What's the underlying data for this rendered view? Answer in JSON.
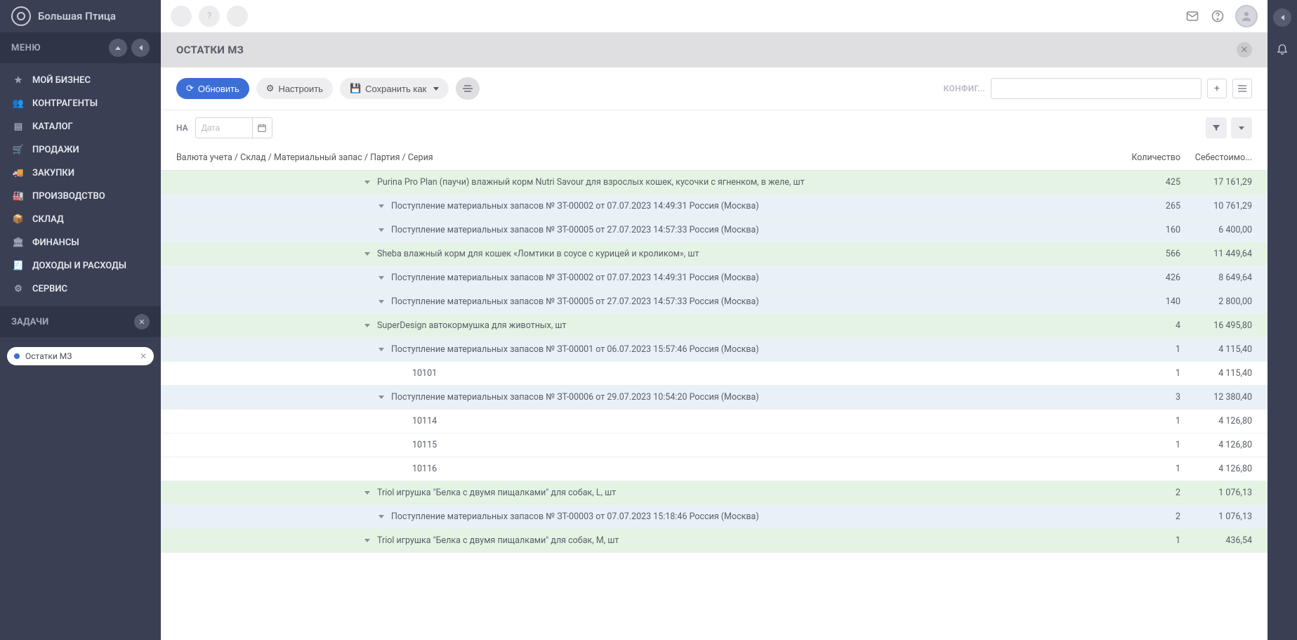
{
  "app": {
    "name": "Большая Птица"
  },
  "sidebar": {
    "menu_label": "МЕНЮ",
    "items": [
      {
        "label": "МОЙ БИЗНЕС",
        "icon": "star"
      },
      {
        "label": "КОНТРАГЕНТЫ",
        "icon": "users"
      },
      {
        "label": "КАТАЛОГ",
        "icon": "book"
      },
      {
        "label": "ПРОДАЖИ",
        "icon": "cart"
      },
      {
        "label": "ЗАКУПКИ",
        "icon": "truck"
      },
      {
        "label": "ПРОИЗВОДСТВО",
        "icon": "factory"
      },
      {
        "label": "СКЛАД",
        "icon": "box"
      },
      {
        "label": "ФИНАНСЫ",
        "icon": "bank"
      },
      {
        "label": "ДОХОДЫ И РАСХОДЫ",
        "icon": "ledger"
      },
      {
        "label": "СЕРВИС",
        "icon": "gear"
      }
    ],
    "tasks_label": "ЗАДАЧИ",
    "task_items": [
      {
        "label": "Остатки МЗ"
      }
    ]
  },
  "page": {
    "title": "ОСТАТКИ МЗ"
  },
  "toolbar": {
    "refresh": "Обновить",
    "configure": "Настроить",
    "save_as": "Сохранить как",
    "config_label": "КОНФИГ..."
  },
  "filter": {
    "on_label": "НА",
    "date_placeholder": "Дата"
  },
  "table": {
    "columns": {
      "name": "Валюта учета / Склад / Материальный запас / Партия / Серия",
      "qty": "Количество",
      "cost": "Себестоимо..."
    },
    "rows": [
      {
        "level": 1,
        "caret": true,
        "name": "Purina Pro Plan (паучи) влажный корм Nutri Savour для взрослых кошек, кусочки с ягненком, в желе, шт",
        "qty": "425",
        "cost": "17 161,29"
      },
      {
        "level": 2,
        "caret": true,
        "name": "Поступление материальных запасов № ЗТ-00002 от 07.07.2023 14:49:31 Россия (Москва)",
        "qty": "265",
        "cost": "10 761,29"
      },
      {
        "level": 2,
        "caret": true,
        "name": "Поступление материальных запасов № ЗТ-00005 от 27.07.2023 14:57:33 Россия (Москва)",
        "qty": "160",
        "cost": "6 400,00"
      },
      {
        "level": 1,
        "caret": true,
        "name": "Sheba влажный корм для кошек «Ломтики в соусе с курицей и кроликом», шт",
        "qty": "566",
        "cost": "11 449,64"
      },
      {
        "level": 2,
        "caret": true,
        "name": "Поступление материальных запасов № ЗТ-00002 от 07.07.2023 14:49:31 Россия (Москва)",
        "qty": "426",
        "cost": "8 649,64"
      },
      {
        "level": 2,
        "caret": true,
        "name": "Поступление материальных запасов № ЗТ-00005 от 27.07.2023 14:57:33 Россия (Москва)",
        "qty": "140",
        "cost": "2 800,00"
      },
      {
        "level": 1,
        "caret": true,
        "name": "SuperDesign автокормушка для животных, шт",
        "qty": "4",
        "cost": "16 495,80"
      },
      {
        "level": 2,
        "caret": true,
        "name": "Поступление материальных запасов № ЗТ-00001 от 06.07.2023 15:57:46 Россия (Москва)",
        "qty": "1",
        "cost": "4 115,40"
      },
      {
        "level": 3,
        "caret": false,
        "name": "10101",
        "qty": "1",
        "cost": "4 115,40"
      },
      {
        "level": 2,
        "caret": true,
        "name": "Поступление материальных запасов № ЗТ-00006 от 29.07.2023 10:54:20 Россия (Москва)",
        "qty": "3",
        "cost": "12 380,40"
      },
      {
        "level": 3,
        "caret": false,
        "name": "10114",
        "qty": "1",
        "cost": "4 126,80"
      },
      {
        "level": 3,
        "caret": false,
        "name": "10115",
        "qty": "1",
        "cost": "4 126,80"
      },
      {
        "level": 3,
        "caret": false,
        "name": "10116",
        "qty": "1",
        "cost": "4 126,80"
      },
      {
        "level": 1,
        "caret": true,
        "name": "Triol игрушка \"Белка с двумя пищалками\" для собак, L, шт",
        "qty": "2",
        "cost": "1 076,13"
      },
      {
        "level": 2,
        "caret": true,
        "name": "Поступление материальных запасов № ЗТ-00003 от 07.07.2023 15:18:46 Россия (Москва)",
        "qty": "2",
        "cost": "1 076,13"
      },
      {
        "level": 1,
        "caret": true,
        "name": "Triol игрушка \"Белка с двумя пищалками\" для собак, M, шт",
        "qty": "1",
        "cost": "436,54"
      }
    ]
  }
}
